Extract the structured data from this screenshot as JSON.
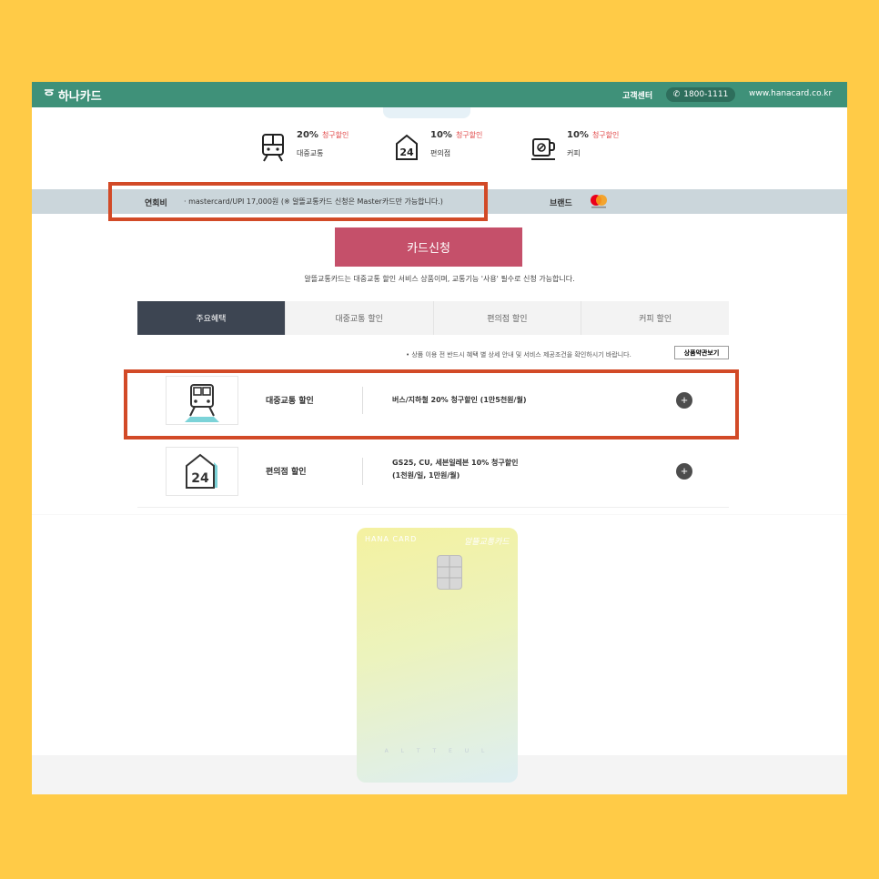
{
  "header": {
    "logo_text": "하나카드",
    "customer_center": "고객센터",
    "phone": "1800-1111",
    "website": "www.hanacard.co.kr"
  },
  "benefits_summary": [
    {
      "percent": "20%",
      "tag": "청구할인",
      "name": "대중교통",
      "icon": "train-icon"
    },
    {
      "percent": "10%",
      "tag": "청구할인",
      "name": "편의점",
      "icon": "convenience-store-24-icon"
    },
    {
      "percent": "10%",
      "tag": "청구할인",
      "name": "커피",
      "icon": "coffee-cup-icon"
    }
  ],
  "fee": {
    "label": "연회비",
    "value": "· mastercard/UPI 17,000원 (※ 알뜰교통카드 신청은 Master카드만 가능합니다.)",
    "brand_label": "브랜드",
    "brand_icon": "mastercard-icon"
  },
  "apply": {
    "button_label": "카드신청",
    "note": "알뜰교통카드는 대중교통 할인 서비스 상품이며, 교통기능 '사용' 필수로 신청 가능합니다."
  },
  "tabs": [
    {
      "label": "주요혜택",
      "active": true
    },
    {
      "label": "대중교통 할인",
      "active": false
    },
    {
      "label": "편의점 할인",
      "active": false
    },
    {
      "label": "커피 할인",
      "active": false
    }
  ],
  "notice": {
    "text": "• 상품 이용 전 반드시 혜택 별 상세 안내 및 서비스 제공조건을 확인하시기 바랍니다.",
    "terms_button": "상품약관보기"
  },
  "benefit_rows": [
    {
      "title": "대중교통 할인",
      "desc_line1": "버스/지하철 20% 청구할인 (1만5천원/월)",
      "desc_line2": "",
      "icon": "train-icon"
    },
    {
      "title": "편의점 할인",
      "desc_line1": "GS25, CU, 세븐일레븐 10% 청구할인",
      "desc_line2": "(1천원/일, 1만원/월)",
      "icon": "convenience-store-24-icon"
    }
  ],
  "card": {
    "issuer": "HANA CARD",
    "name": "알뜰교통카드",
    "bottom_text": "A L T T E U L"
  },
  "colors": {
    "header_green": "#3F9179",
    "apply_button": "#C5506A",
    "active_tab": "#3D4552",
    "highlight_box": "#D24A27",
    "background": "#FFCB47"
  }
}
